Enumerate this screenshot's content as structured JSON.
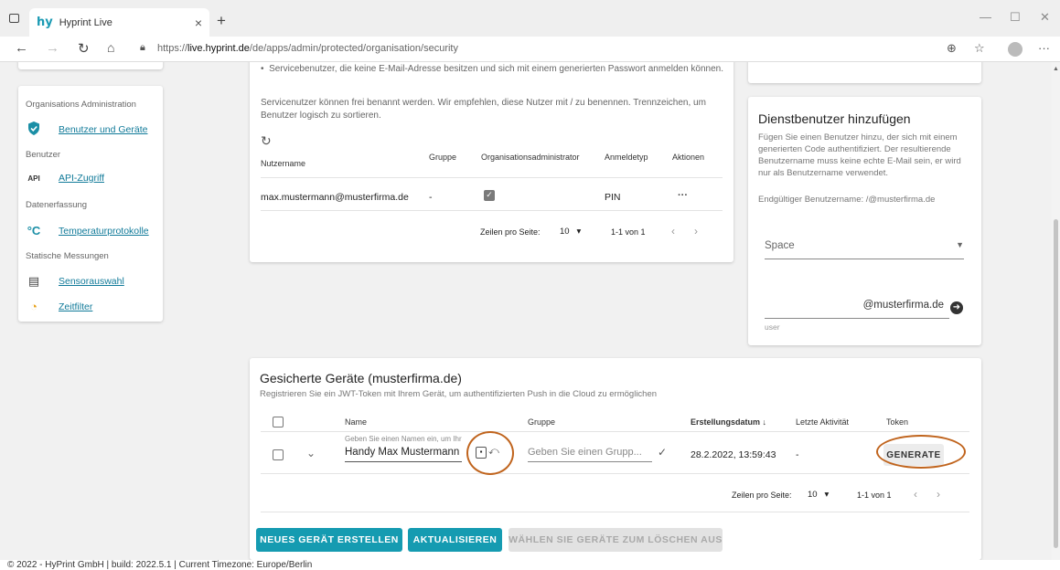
{
  "browser": {
    "tab_title": "Hyprint Live",
    "tab_logo": "hy",
    "url_prefix": "https://",
    "url_host": "live.hyprint.de",
    "url_path": "/de/apps/admin/protected/organisation/security"
  },
  "sidebar": {
    "section_admin": "Organisations Administration",
    "item_users": "Benutzer und Geräte",
    "section_user": "Benutzer",
    "item_api": "API-Zugriff",
    "item_api_icon": "API",
    "section_data": "Datenerfassung",
    "item_temp": "Temperaturprotokolle",
    "section_static": "Statische Messungen",
    "item_sensor": "Sensorauswahl",
    "item_time": "Zeitfilter"
  },
  "service": {
    "bullet": "Servicebenutzer, die keine E-Mail-Adresse besitzen und sich mit einem generierten Passwort anmelden können.",
    "info": "Servicenutzer können frei benannt werden. Wir empfehlen, diese Nutzer mit / zu benennen. Trennzeichen, um Benutzer logisch zu sortieren.",
    "headers": {
      "name": "Nutzername",
      "group": "Gruppe",
      "admin": "Organisationsadministrator",
      "login": "Anmeldetyp",
      "actions": "Aktionen"
    },
    "row": {
      "name": "max.mustermann@musterfirma.de",
      "group": "-",
      "login": "PIN",
      "actions": "···"
    },
    "pagination": {
      "rows_label": "Zeilen pro Seite:",
      "rows_value": "10",
      "range": "1-1 von 1"
    }
  },
  "add_service": {
    "title": "Dienstbenutzer hinzufügen",
    "description": "Fügen Sie einen Benutzer hinzu, der sich mit einem generierten Code authentifiziert. Der resultierende Benutzername muss keine echte E-Mail sein, er wird nur als Benutzername verwendet.",
    "final_username": "Endgültiger Benutzername: /@musterfirma.de",
    "space_label": "Space",
    "domain_suffix": "@musterfirma.de",
    "user_hint": "user"
  },
  "devices": {
    "title": "Gesicherte Geräte (musterfirma.de)",
    "subtitle": "Registrieren Sie ein JWT-Token mit Ihrem Gerät, um authentifizierten Push in die Cloud zu ermöglichen",
    "headers": {
      "name": "Name",
      "group": "Gruppe",
      "created": "Erstellungsdatum",
      "last": "Letzte Aktivität",
      "token": "Token"
    },
    "row": {
      "name_label": "Geben Sie einen Namen ein, um Ihr",
      "name_value": "Handy Max Mustermann",
      "group_placeholder": "Geben Sie einen Grupp...",
      "created": "28.2.2022, 13:59:43",
      "last": "-",
      "token_button": "GENERATE"
    },
    "pagination": {
      "rows_label": "Zeilen pro Seite:",
      "rows_value": "10",
      "range": "1-1 von 1"
    },
    "buttons": {
      "create": "NEUES GERÄT ERSTELLEN",
      "refresh": "AKTUALISIEREN",
      "delete": "WÄHLEN SIE GERÄTE ZUM LÖSCHEN AUS"
    }
  },
  "footer": "© 2022 - HyPrint GmbH | build: 2022.5.1 | Current Timezone: Europe/Berlin",
  "colors": {
    "accent": "#159bb1",
    "annotation": "#c0641d"
  }
}
